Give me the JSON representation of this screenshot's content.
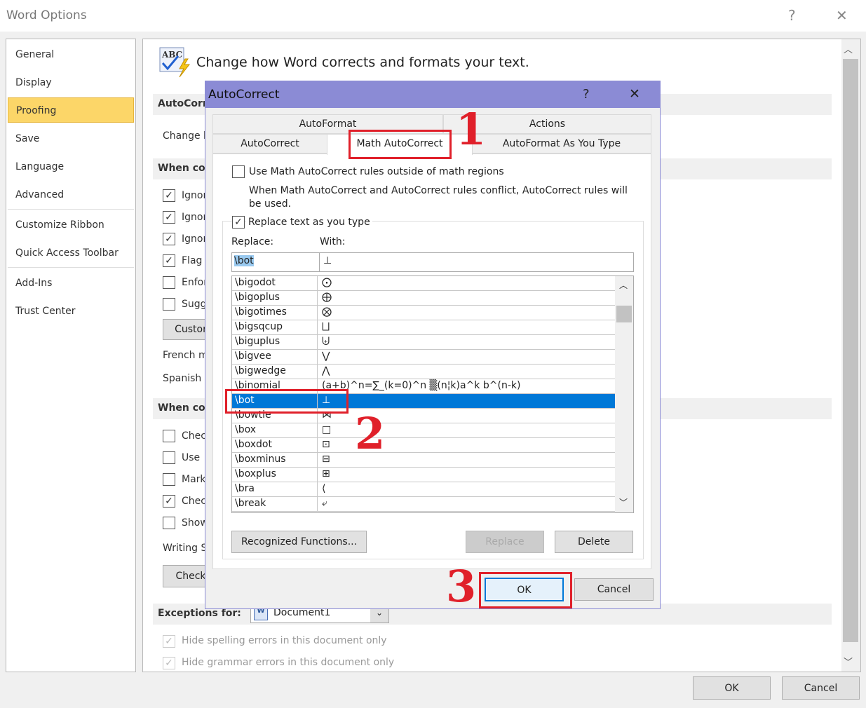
{
  "window": {
    "title": "Word Options",
    "help": "?",
    "close": "✕"
  },
  "nav": {
    "items": [
      "General",
      "Display",
      "Proofing",
      "Save",
      "Language",
      "Advanced",
      "Customize Ribbon",
      "Quick Access Toolbar",
      "Add-Ins",
      "Trust Center"
    ],
    "selected": "Proofing"
  },
  "content": {
    "heading": "Change how Word corrects and formats your text.",
    "autocorrect_section": "AutoCorr",
    "change_text": "Change h",
    "when_section1": "When co",
    "checks1": [
      {
        "label": "Ignor",
        "checked": true
      },
      {
        "label": "Ignor",
        "checked": true
      },
      {
        "label": "Ignor",
        "checked": true
      },
      {
        "label": "Flag",
        "checked": true
      },
      {
        "label": "Enfor",
        "checked": false
      },
      {
        "label": "Sugg",
        "checked": false
      }
    ],
    "custom_btn": "Custor",
    "french": "French m",
    "spanish": "Spanish",
    "when_section2": "When co",
    "checks2": [
      {
        "label": "Chec",
        "checked": false
      },
      {
        "label": "Use",
        "checked": false
      },
      {
        "label": "Mark",
        "checked": false
      },
      {
        "label": "Chec",
        "checked": true
      },
      {
        "label": "Show",
        "checked": false
      }
    ],
    "writing": "Writing S",
    "check_btn": "Check",
    "exceptions_label": "Exceptions for:",
    "exceptions_value": "Document1",
    "hide_spelling": "Hide spelling errors in this document only",
    "hide_grammar": "Hide grammar errors in this document only"
  },
  "footer": {
    "ok": "OK",
    "cancel": "Cancel"
  },
  "dialog": {
    "title": "AutoCorrect",
    "help": "?",
    "close": "✕",
    "tabs_row1": [
      "AutoFormat",
      "Actions"
    ],
    "tabs_row2": [
      "AutoCorrect",
      "Math AutoCorrect",
      "AutoFormat As You Type"
    ],
    "selected_tab": "Math AutoCorrect",
    "use_outside": {
      "label": "Use Math AutoCorrect rules outside of math regions",
      "checked": false
    },
    "conflict_note": "When Math AutoCorrect and AutoCorrect rules conflict, AutoCorrect rules will be used.",
    "replace_as_type": {
      "label": "Replace text as you type",
      "checked": true
    },
    "replace_label": "Replace:",
    "with_label": "With:",
    "replace_value": "\\bot",
    "with_value": "⊥",
    "entries": [
      {
        "name": "\\bigodot",
        "symbol": "⨀"
      },
      {
        "name": "\\bigoplus",
        "symbol": "⨁"
      },
      {
        "name": "\\bigotimes",
        "symbol": "⨂"
      },
      {
        "name": "\\bigsqcup",
        "symbol": "⨆"
      },
      {
        "name": "\\biguplus",
        "symbol": "⨄"
      },
      {
        "name": "\\bigvee",
        "symbol": "⋁"
      },
      {
        "name": "\\bigwedge",
        "symbol": "⋀"
      },
      {
        "name": "\\binomial",
        "symbol": "(a+b)^n=∑_(k=0)^n ▒(n¦k)a^k b^(n-k)"
      },
      {
        "name": "\\bot",
        "symbol": "⊥"
      },
      {
        "name": "\\bowtie",
        "symbol": "⋈"
      },
      {
        "name": "\\box",
        "symbol": "□"
      },
      {
        "name": "\\boxdot",
        "symbol": "⊡"
      },
      {
        "name": "\\boxminus",
        "symbol": "⊟"
      },
      {
        "name": "\\boxplus",
        "symbol": "⊞"
      },
      {
        "name": "\\bra",
        "symbol": "⟨"
      },
      {
        "name": "\\break",
        "symbol": "⤶"
      }
    ],
    "selected_entry": "\\bot",
    "recognized_btn": "Recognized Functions...",
    "replace_btn": "Replace",
    "delete_btn": "Delete",
    "ok": "OK",
    "cancel": "Cancel"
  },
  "annotations": [
    "1",
    "2",
    "3"
  ],
  "colors": {
    "dialog_title": "#8b8bd5",
    "selection": "#0078d7",
    "nav_selected": "#fcd668",
    "annotation": "#e0202a"
  }
}
